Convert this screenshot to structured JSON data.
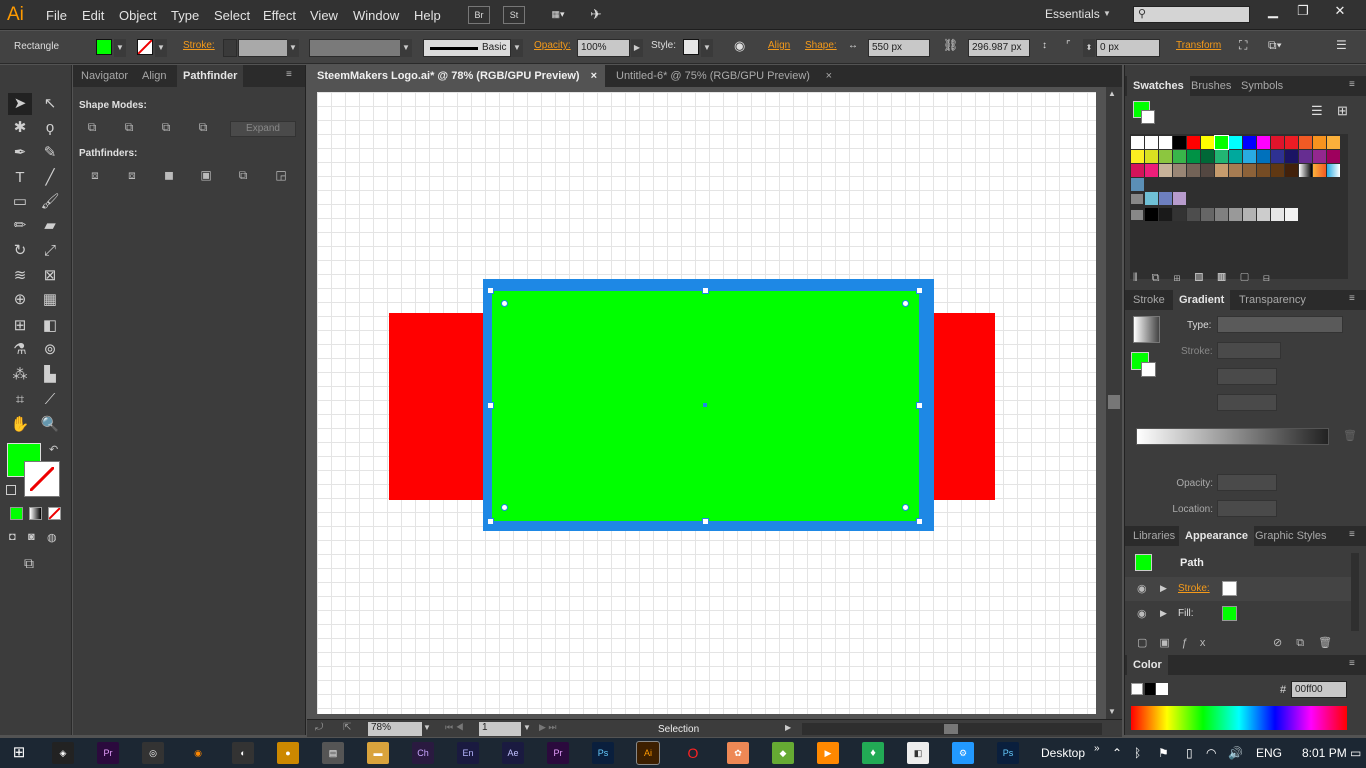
{
  "app": {
    "logo": "Ai",
    "workspace": "Essentials",
    "bridge": "Br",
    "stock": "St"
  },
  "menu": [
    "File",
    "Edit",
    "Object",
    "Type",
    "Select",
    "Effect",
    "View",
    "Window",
    "Help"
  ],
  "control": {
    "tool_name": "Rectangle",
    "stroke_label": "Stroke:",
    "brush_label": "Basic",
    "opacity_label": "Opacity:",
    "opacity_value": "100%",
    "style_label": "Style:",
    "align_label": "Align",
    "shape_label": "Shape:",
    "width_value": "550 px",
    "height_value": "296.987 px",
    "corner_value": "0 px",
    "transform_label": "Transform"
  },
  "left_panel": {
    "tabs": [
      "Navigator",
      "Align",
      "Pathfinder"
    ],
    "shape_modes_label": "Shape Modes:",
    "expand_label": "Expand",
    "pathfinders_label": "Pathfinders:"
  },
  "documents": [
    {
      "title": "SteemMakers Logo.ai* @ 78% (RGB/GPU Preview)",
      "close": "×"
    },
    {
      "title": "Untitled-6* @ 75% (RGB/GPU Preview)",
      "close": "×"
    }
  ],
  "status": {
    "zoom": "78%",
    "artboard": "1",
    "tool": "Selection"
  },
  "swatches_panel": {
    "tabs": [
      "Swatches",
      "Brushes",
      "Symbols"
    ]
  },
  "gradient_panel": {
    "tabs": [
      "Stroke",
      "Gradient",
      "Transparency"
    ],
    "type_label": "Type:",
    "stroke_label": "Stroke:",
    "opacity_label": "Opacity:",
    "location_label": "Location:"
  },
  "appearance_panel": {
    "tabs": [
      "Libraries",
      "Appearance",
      "Graphic Styles"
    ],
    "object": "Path",
    "stroke_label": "Stroke:",
    "fill_label": "Fill:"
  },
  "color_panel": {
    "title": "Color",
    "hash": "#",
    "hex_value": "00ff00"
  },
  "taskbar": {
    "desktop": "Desktop",
    "lang": "ENG",
    "time": "8:01 PM"
  },
  "colors": {
    "fill": "#00ff00",
    "red": "#ff0000",
    "blue": "#1e88e5",
    "accent": "#f49a1a"
  }
}
